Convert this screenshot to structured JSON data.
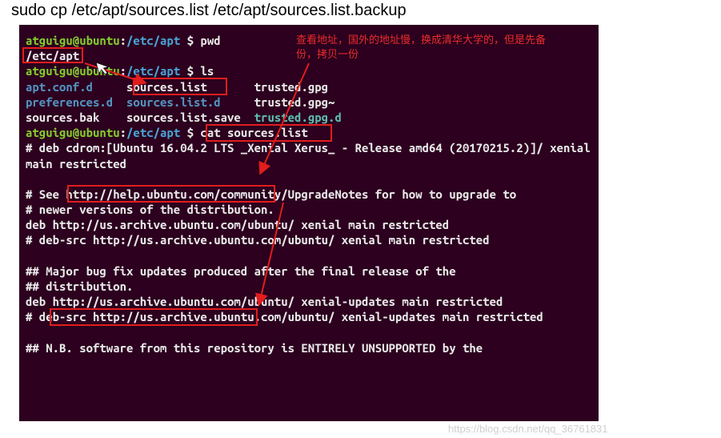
{
  "title": "sudo cp /etc/apt/sources.list /etc/apt/sources.list.backup",
  "prompt": {
    "user_host": "atguigu@ubuntu",
    "path": "/etc/apt",
    "sep": "$",
    "cmd_pwd": "pwd",
    "cmd_ls": "ls",
    "cmd_cat": "cat sources.list"
  },
  "pwd_output": "/etc/apt",
  "annotation": {
    "line1": "查看地址，国外的地址慢，换成清华大学的，但是先备",
    "line2": "份，拷贝一份"
  },
  "ls": {
    "apt_conf_d": "apt.conf.d",
    "preferences_d": "preferences.d",
    "sources_bak": "sources.bak",
    "sources_list": "sources.list",
    "sources_list_d": "sources.list.d",
    "sources_list_save": "sources.list.save",
    "trusted_gpg": "trusted.gpg",
    "trusted_gpg_tilde": "trusted.gpg~",
    "trusted_gpg_d": "trusted.gpg.d"
  },
  "cat_output": {
    "l1": "# deb cdrom:[Ubuntu 16.04.2 LTS _Xenial Xerus_ - Release amd64 (20170215.2)]/ xenial main restricted",
    "l2": "",
    "l3": "# See http://help.ubuntu.com/community/UpgradeNotes for how to upgrade to",
    "l4": "# newer versions of the distribution.",
    "l5": "deb http://us.archive.ubuntu.com/ubuntu/ xenial main restricted",
    "l6": "# deb-src http://us.archive.ubuntu.com/ubuntu/ xenial main restricted",
    "l7": "",
    "l8": "## Major bug fix updates produced after the final release of the",
    "l9": "## distribution.",
    "l10": "deb http://us.archive.ubuntu.com/ubuntu/ xenial-updates main restricted",
    "l11": "# deb-src http://us.archive.ubuntu.com/ubuntu/ xenial-updates main restricted",
    "l12": "",
    "l13": "## N.B. software from this repository is ENTIRELY UNSUPPORTED by the"
  },
  "watermark": "https://blog.csdn.net/qq_36761831"
}
